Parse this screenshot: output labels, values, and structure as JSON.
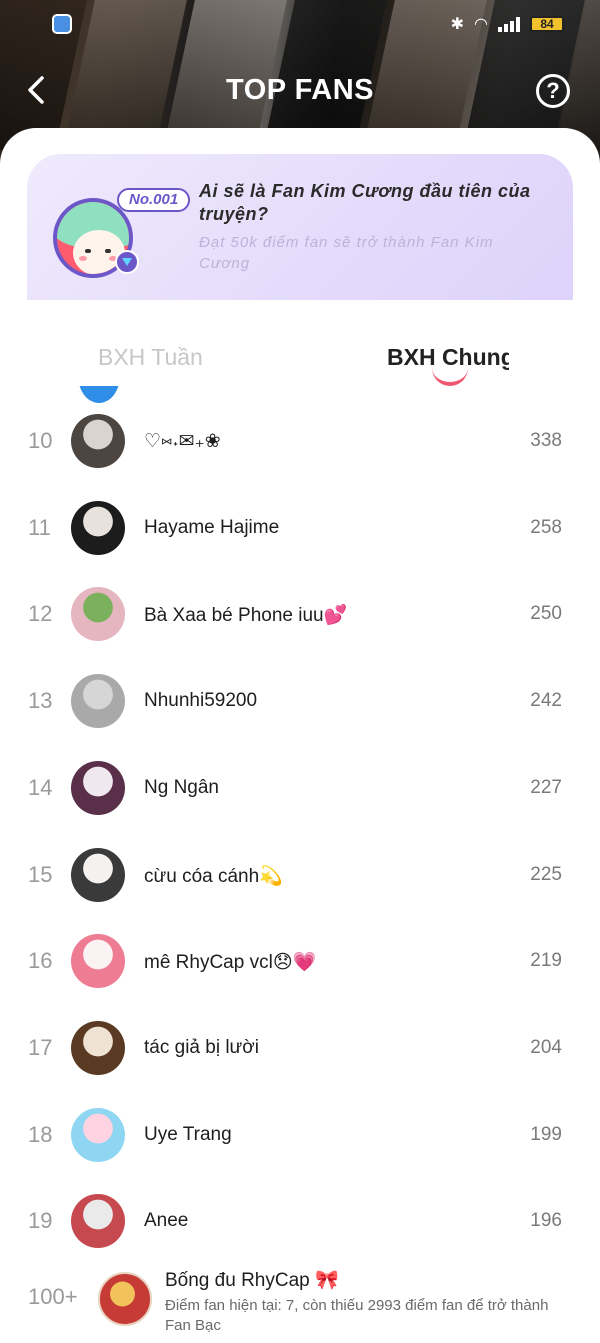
{
  "status_bar": {
    "battery": "84"
  },
  "header": {
    "title": "TOP FANS",
    "help_label": "?"
  },
  "banner": {
    "rank_badge": "No.001",
    "headline": "Ai sẽ là Fan Kim Cương đầu tiên của truyện?",
    "subtext": "Đạt 50k điểm fan sẽ trở thành Fan Kim Cương"
  },
  "tabs": [
    {
      "label": "BXH Tuần",
      "active": false
    },
    {
      "label": "BXH Chung",
      "active": true
    }
  ],
  "leaderboard": [
    {
      "rank": "10",
      "name": "♡⑅˖✉︎₊❀",
      "score": "338",
      "avatar_colors": [
        "#d9d4cf",
        "#4c4540"
      ]
    },
    {
      "rank": "11",
      "name": "Hayame Hajime",
      "score": "258",
      "avatar_colors": [
        "#e8e2dc",
        "#1c1c1c"
      ]
    },
    {
      "rank": "12",
      "name": "Bà Xaa bé Phone iuu💕",
      "score": "250",
      "avatar_colors": [
        "#7bb05d",
        "#e6b6c0"
      ]
    },
    {
      "rank": "13",
      "name": "Nhunhi59200",
      "score": "242",
      "avatar_colors": [
        "#d6d6d6",
        "#a9a9a9"
      ]
    },
    {
      "rank": "14",
      "name": "Ng Ngân",
      "score": "227",
      "avatar_colors": [
        "#efe8ee",
        "#5a2f4a"
      ]
    },
    {
      "rank": "15",
      "name": "cừu cóa cánh💫",
      "score": "225",
      "avatar_colors": [
        "#f4f1ee",
        "#3a3a3a"
      ]
    },
    {
      "rank": "16",
      "name": "mê RhyCap vcl😞💗",
      "score": "219",
      "avatar_colors": [
        "#fbf2f4",
        "#ee7c92"
      ]
    },
    {
      "rank": "17",
      "name": "tác giả bị lười",
      "score": "204",
      "avatar_colors": [
        "#efe2d3",
        "#5a3a22"
      ]
    },
    {
      "rank": "18",
      "name": "Uye Trang",
      "score": "199",
      "avatar_colors": [
        "#ffd3e1",
        "#8fd6f2"
      ]
    },
    {
      "rank": "19",
      "name": "Anee",
      "score": "196",
      "avatar_colors": [
        "#eaeaea",
        "#c6494f"
      ]
    }
  ],
  "my_rank": {
    "rank": "100+",
    "name": "Bống đu RhyCap 🎀",
    "progress_text": "Điểm fan hiện tại: 7, còn thiếu 2993 điểm fan để trở thành Fan Bạc"
  },
  "colors": {
    "accent": "#f05870",
    "brand_purple": "#6c57c9",
    "banner_bg": "#e4dbfb"
  }
}
